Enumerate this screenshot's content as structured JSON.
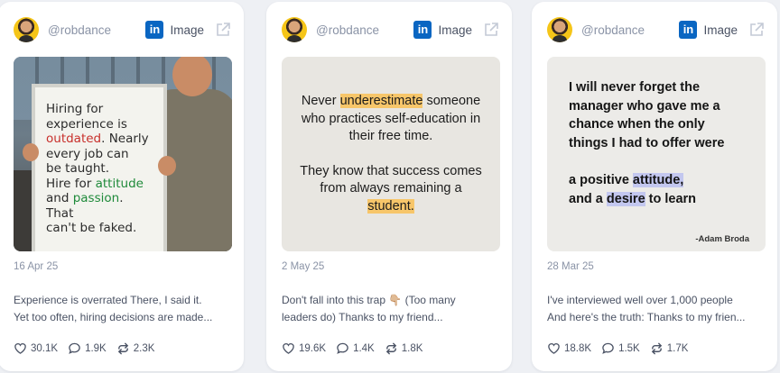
{
  "cards": [
    {
      "author": "@robdance",
      "type_label": "Image",
      "date": "16 Apr 25",
      "excerpt_line1": "Experience is overrated   There, I said it.",
      "excerpt_line2": "Yet too often, hiring decisions are made...",
      "likes": "30.1K",
      "comments": "1.9K",
      "reposts": "2.3K",
      "image_text": {
        "l1": "Hiring for",
        "l2": "experience is",
        "l3a": "outdated",
        "l3b": ". Nearly",
        "l4": "every job can",
        "l5": "be taught.",
        "l6a": "Hire for ",
        "l6b": "attitude",
        "l7a": "and ",
        "l7b": "passion",
        "l7c": ". That",
        "l8": "can't be faked."
      }
    },
    {
      "author": "@robdance",
      "type_label": "Image",
      "date": "2 May 25",
      "excerpt_line1": "Don't fall into this trap 👇🏼   (Too many",
      "excerpt_line2": "leaders do)    Thanks to my friend...",
      "likes": "19.6K",
      "comments": "1.4K",
      "reposts": "1.8K",
      "image_text": {
        "p1a": "Never ",
        "p1b": "underestimate",
        "p1c": " someone",
        "p2": "who practices self-education in",
        "p3": "their free time.",
        "p4": "They know that success comes",
        "p5": "from always remaining a",
        "p6": "student."
      }
    },
    {
      "author": "@robdance",
      "type_label": "Image",
      "date": "28 Mar 25",
      "excerpt_line1": "I've interviewed well over 1,000 people",
      "excerpt_line2": "And here's the truth:   Thanks to my frien...",
      "likes": "18.8K",
      "comments": "1.5K",
      "reposts": "1.7K",
      "image_text": {
        "p1": "I will never forget the",
        "p2": "manager who gave me a",
        "p3": "chance when the only",
        "p4": "things I had to offer were",
        "p5a": "a positive ",
        "p5b": "attitude,",
        "p6a": "and a ",
        "p6b": "desire",
        "p6c": " to learn",
        "signature": "-Adam Broda"
      }
    }
  ],
  "icons": {
    "platform": "linkedin-icon",
    "external": "external-link-icon",
    "like": "heart-icon",
    "comment": "comment-icon",
    "repost": "repost-icon"
  },
  "colors": {
    "linkedin": "#0a66c2",
    "highlight_orange": "#f7c66a",
    "highlight_purple": "#c3c7ef"
  }
}
